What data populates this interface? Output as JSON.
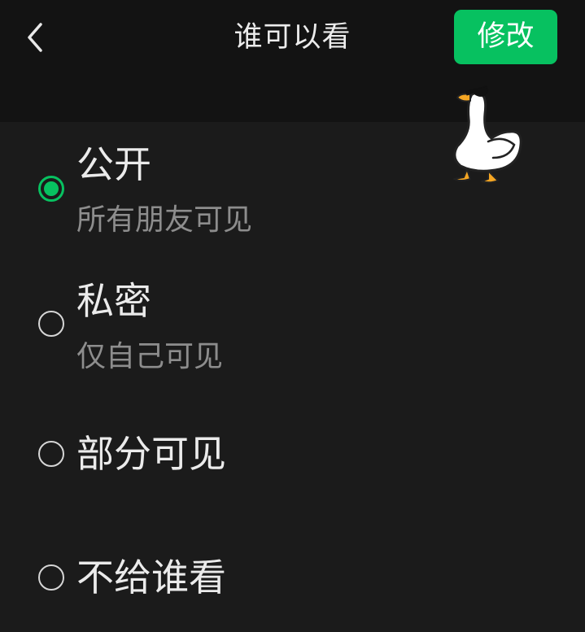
{
  "header": {
    "back_icon": "chevron-left-icon",
    "title": "谁可以看",
    "modify_label": "修改",
    "accent_color": "#07c160"
  },
  "options": [
    {
      "label": "公开",
      "description": "所有朋友可见",
      "selected": true
    },
    {
      "label": "私密",
      "description": "仅自己可见",
      "selected": false
    },
    {
      "label": "部分可见",
      "selected": false
    },
    {
      "label": "不给谁看",
      "selected": false
    }
  ],
  "decoration": {
    "mascot_icon": "goose-sticker-icon"
  }
}
